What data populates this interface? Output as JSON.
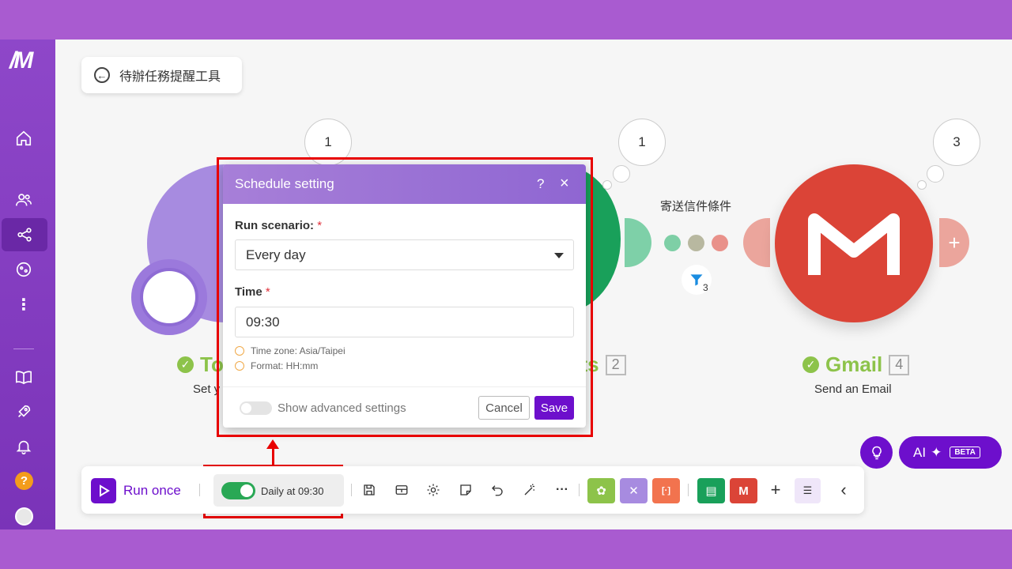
{
  "scenario": {
    "title": "待辦任務提醒工具"
  },
  "modules": [
    {
      "title": "To",
      "subtitle": "Set y",
      "bubble": "1"
    },
    {
      "title": "ets",
      "number": "2",
      "bubble": "1"
    },
    {
      "title": "Gmail",
      "number": "4",
      "subtitle": "Send an Email",
      "bubble": "3"
    }
  ],
  "filter": {
    "label": "寄送信件條件",
    "count": "3"
  },
  "dialog": {
    "title": "Schedule setting",
    "help": "?",
    "close": "×",
    "run_label": "Run scenario:",
    "required_mark": "*",
    "run_value": "Every day",
    "time_label": "Time",
    "time_value": "09:30",
    "hint_timezone": "Time zone: Asia/Taipei",
    "hint_format": "Format: HH:mm",
    "advanced_label": "Show advanced settings",
    "cancel": "Cancel",
    "save": "Save"
  },
  "toolbar": {
    "run_once": "Run once",
    "schedule_label": "Daily at 09:30",
    "more": "···",
    "add": "+",
    "collapse": "‹"
  },
  "ai": {
    "label": "AI",
    "badge": "BETA"
  },
  "sidebar": {
    "help": "?"
  },
  "colors": {
    "accent": "#6d0fcc",
    "gmail": "#db4437",
    "success": "#8dc34a",
    "highlight": "#e80000"
  }
}
